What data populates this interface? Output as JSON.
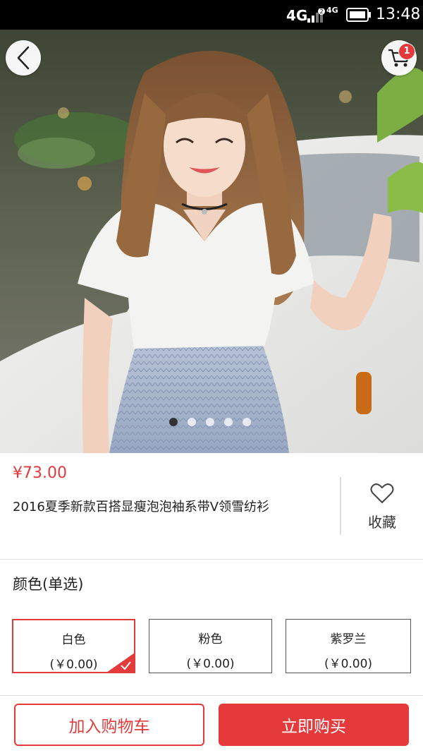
{
  "status_bar": {
    "network": "4G",
    "network_secondary": "4G",
    "sim_index": "2",
    "time": "13:48"
  },
  "product_gallery": {
    "cart_badge_count": "1",
    "page_count": 5,
    "active_page": 1
  },
  "product": {
    "price": "¥73.00",
    "title": "2016夏季新款百搭显瘦泡泡袖系带V领雪纺衫",
    "favorite_label": "收藏"
  },
  "color_selector": {
    "title": "颜色(单选)",
    "options": [
      {
        "name": "白色",
        "price": "(￥0.00)",
        "selected": true
      },
      {
        "name": "粉色",
        "price": "(￥0.00)",
        "selected": false
      },
      {
        "name": "紫罗兰",
        "price": "(￥0.00)",
        "selected": false
      }
    ]
  },
  "actions": {
    "add_to_cart": "加入购物车",
    "buy_now": "立即购买"
  },
  "colors": {
    "accent": "#e43a3c",
    "status_bar": "#000000"
  }
}
